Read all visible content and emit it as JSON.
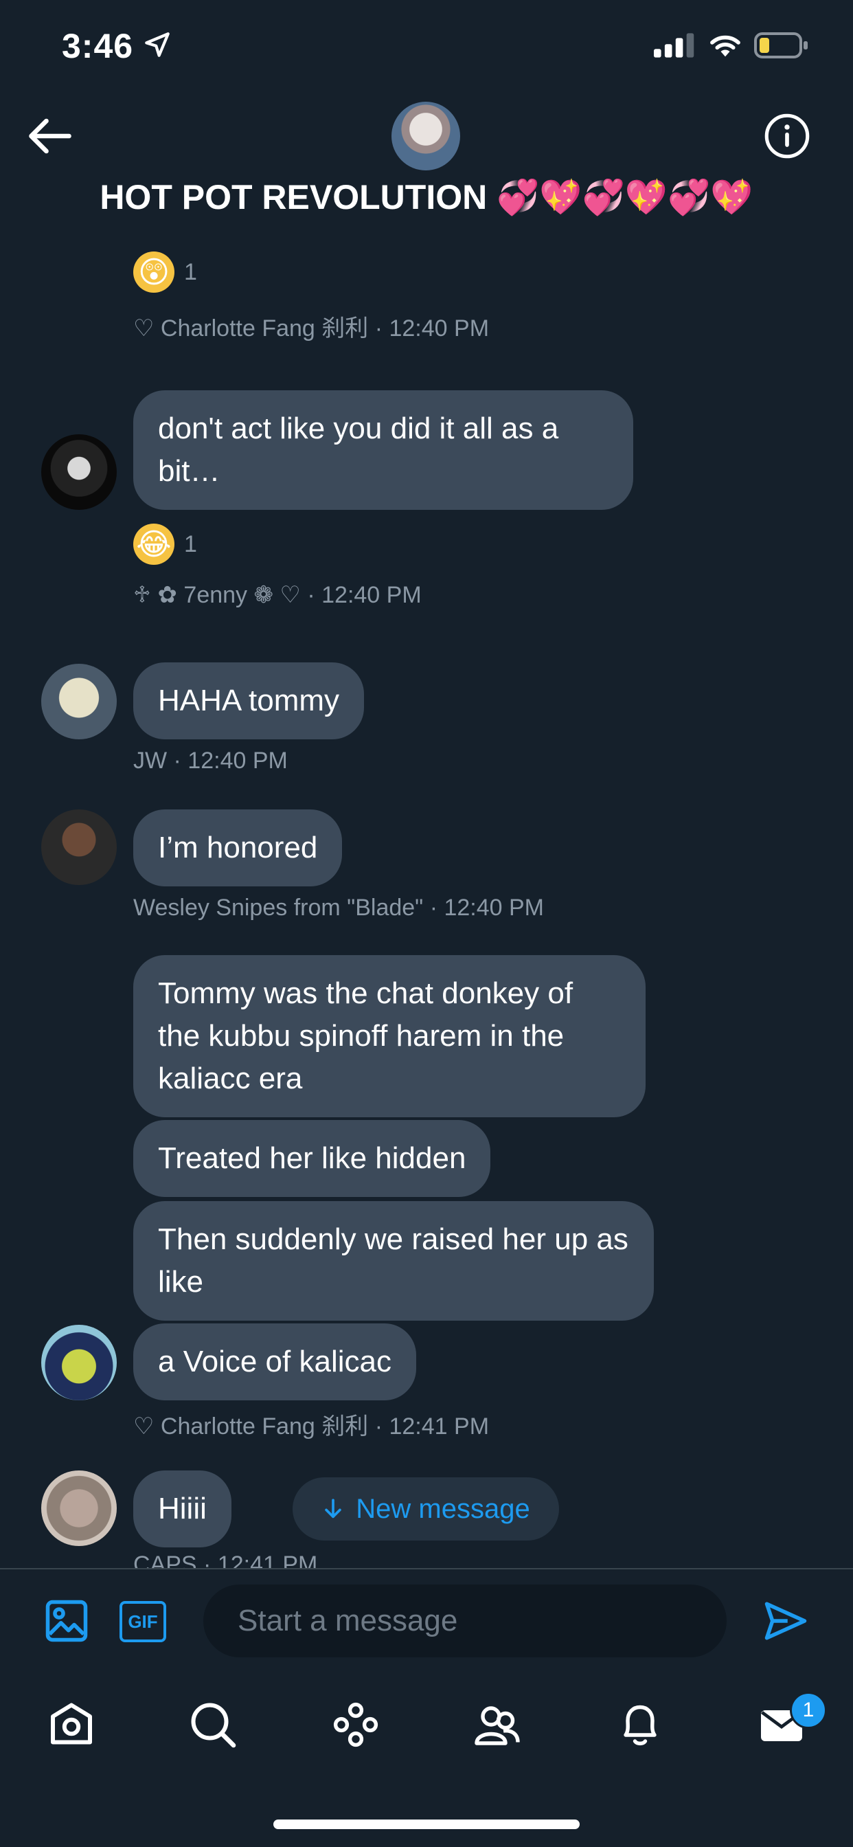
{
  "status_bar": {
    "time": "3:46"
  },
  "header": {
    "title": "HOT POT REVOLUTION 💞💖💞💖💞💖"
  },
  "messages": {
    "m1": {
      "reaction_count": "1",
      "meta": "♡ Charlotte Fang 刹利 · 12:40 PM"
    },
    "m2": {
      "text": "don't act like you did it all as a bit…",
      "reaction_count": "1",
      "meta": "♱ ✿ 7enny ❁ ♡ · 12:40 PM"
    },
    "m3": {
      "text": "HAHA tommy",
      "meta": "JW · 12:40 PM"
    },
    "m4": {
      "text": "I’m honored",
      "meta": "Wesley Snipes from \"Blade\" · 12:40 PM"
    },
    "m5": {
      "bubbles": [
        "Tommy was the chat donkey of the kubbu spinoff harem in the kaliacc era",
        "Treated her like hidden",
        "Then suddenly we raised her up as like",
        "a Voice of kalicac"
      ],
      "meta": "♡ Charlotte Fang 刹利 · 12:41 PM"
    },
    "m6": {
      "text": "Hiiii",
      "meta": "CAPS · 12:41 PM"
    }
  },
  "new_message_button": {
    "label": "New message"
  },
  "composer": {
    "placeholder": "Start a message",
    "gif_label": "GIF"
  },
  "tabbar": {
    "messages_badge": "1"
  },
  "colors": {
    "background": "#15202b",
    "bubble": "#3c4a5a",
    "accent": "#1d9bf0",
    "meta": "#8b98a5"
  },
  "icons": [
    "back-arrow-icon",
    "info-icon",
    "image-icon",
    "gif-icon",
    "send-icon",
    "home-icon",
    "search-icon",
    "spaces-icon",
    "communities-icon",
    "notifications-icon",
    "messages-icon"
  ]
}
